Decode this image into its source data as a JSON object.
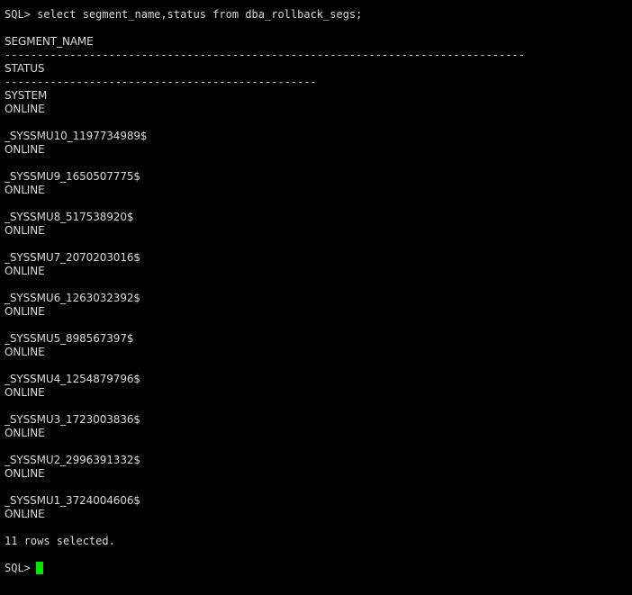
{
  "terminal": {
    "command_prompt": "SQL>",
    "command_text": " select segment_name,status from dba_rollback_segs;",
    "header_segment_name": "SEGMENT_NAME",
    "separator_long": "--------------------------------------------------------------------------------",
    "header_status": "STATUS",
    "separator_short": "------------------------------------------------",
    "rows": [
      {
        "segment_name": "SYSTEM",
        "status": "ONLINE"
      },
      {
        "segment_name": "_SYSSMU10_1197734989$",
        "status": "ONLINE"
      },
      {
        "segment_name": "_SYSSMU9_1650507775$",
        "status": "ONLINE"
      },
      {
        "segment_name": "_SYSSMU8_517538920$",
        "status": "ONLINE"
      },
      {
        "segment_name": "_SYSSMU7_2070203016$",
        "status": "ONLINE"
      },
      {
        "segment_name": "_SYSSMU6_1263032392$",
        "status": "ONLINE"
      },
      {
        "segment_name": "_SYSSMU5_898567397$",
        "status": "ONLINE"
      },
      {
        "segment_name": "_SYSSMU4_1254879796$",
        "status": "ONLINE"
      },
      {
        "segment_name": "_SYSSMU3_1723003836$",
        "status": "ONLINE"
      },
      {
        "segment_name": "_SYSSMU2_2996391332$",
        "status": "ONLINE"
      },
      {
        "segment_name": "_SYSSMU1_3724004606$",
        "status": "ONLINE"
      }
    ],
    "rows_selected": "11 rows selected.",
    "final_prompt": "SQL>",
    "cursor_color": "#00e600",
    "background_color": "#000000",
    "text_color": "#d9d9d9"
  }
}
